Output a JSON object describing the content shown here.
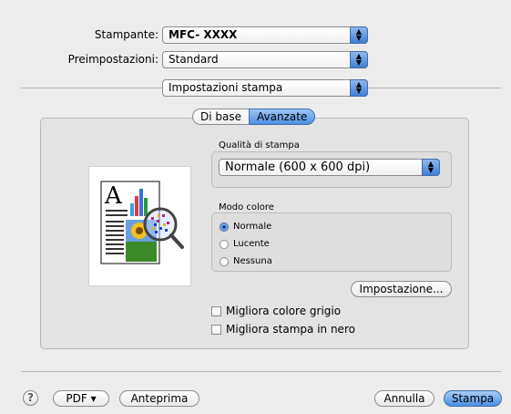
{
  "printer": {
    "label": "Stampante:",
    "value": "MFC- XXXX"
  },
  "presets": {
    "label": "Preimpostazioni:",
    "value": "Standard"
  },
  "section": {
    "value": "Impostazioni stampa"
  },
  "tabs": [
    {
      "label": "Di base",
      "active": false
    },
    {
      "label": "Avanzate",
      "active": true
    }
  ],
  "quality": {
    "label": "Qualità di stampa",
    "value": "Normale (600 x 600 dpi)"
  },
  "color_mode": {
    "label": "Modo colore",
    "options": [
      {
        "label": "Normale",
        "selected": true
      },
      {
        "label": "Lucente",
        "selected": false
      },
      {
        "label": "Nessuna",
        "selected": false
      }
    ]
  },
  "settings_button": "Impostazione...",
  "checkboxes": [
    {
      "label": "Migliora colore grigio",
      "checked": false
    },
    {
      "label": "Migliora stampa in nero",
      "checked": false
    }
  ],
  "footer": {
    "help": "?",
    "pdf": "PDF ▾",
    "preview": "Anteprima",
    "cancel": "Annulla",
    "print": "Stampa"
  },
  "colors": {
    "accent": "#4a8fe3",
    "background": "#ececec"
  }
}
